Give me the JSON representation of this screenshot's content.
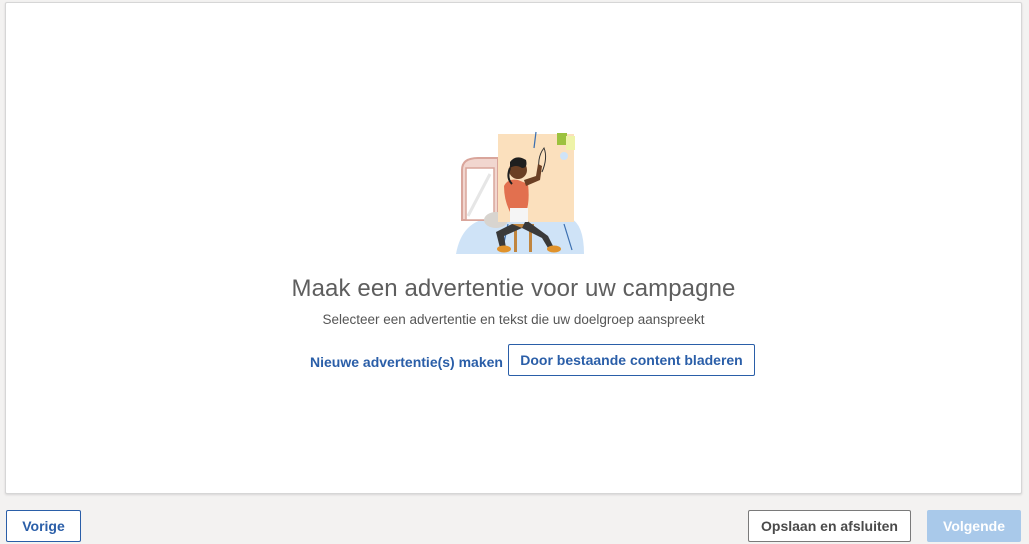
{
  "main": {
    "heading": "Maak een advertentie voor uw campagne",
    "subheading": "Selecteer een advertentie en tekst die uw doelgroep aanspreekt",
    "create_ad_label": "Nieuwe advertentie(s) maken",
    "browse_content_label": "Door bestaande content bladeren",
    "illustration_icon": "person-painting-wall-illustration"
  },
  "footer": {
    "previous_label": "Vorige",
    "save_close_label": "Opslaan en afsluiten",
    "next_label": "Volgende",
    "next_disabled": true
  },
  "colors": {
    "accent": "#2a5ea8",
    "disabled_primary": "#a9c9ea",
    "background": "#f3f2f1"
  }
}
